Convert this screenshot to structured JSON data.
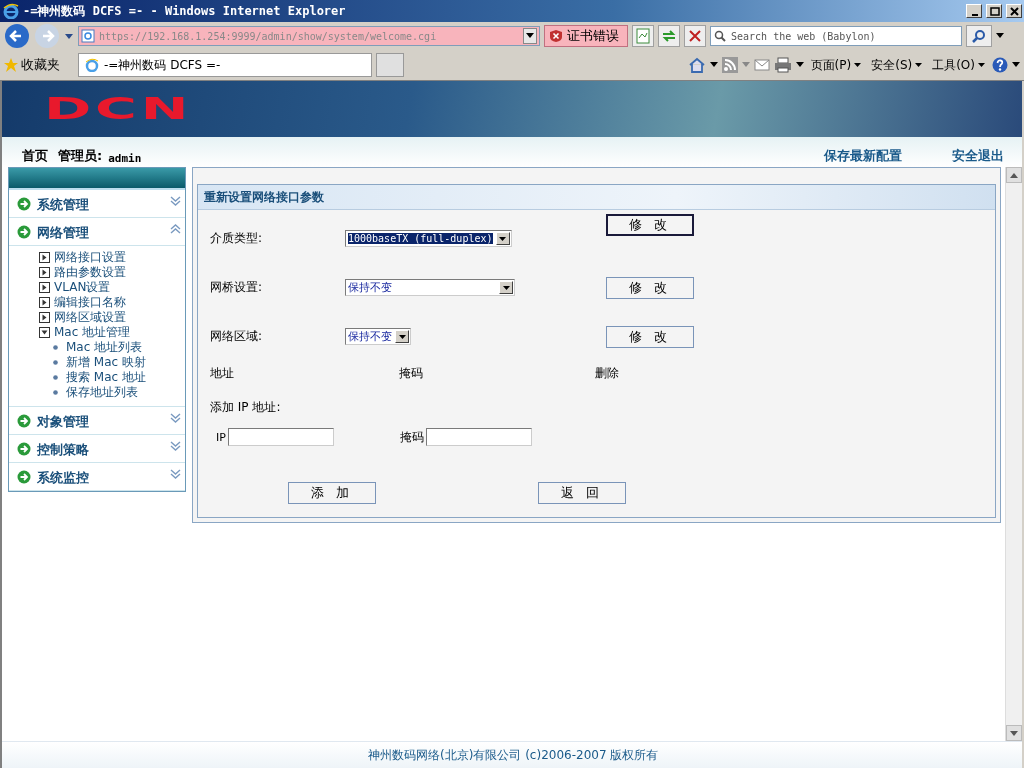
{
  "window": {
    "title": "-=神州数码 DCFS =- - Windows Internet Explorer"
  },
  "browser": {
    "address": "https://192.168.1.254:9999/admin/show/system/welcome.cgi",
    "cert_error": "证书错误",
    "search": {
      "placeholder": "Search the web (Babylon)"
    },
    "favorites": "收藏夹",
    "tabs": [
      {
        "label": "-=神州数码 DCFS =-",
        "selected": true
      }
    ],
    "commands": [
      "页面(P)",
      "安全(S)",
      "工具(O)"
    ]
  },
  "header": {
    "logo": "DCN",
    "home": "首页",
    "admin_label": "管理员:",
    "admin_name": "admin",
    "links": [
      "保存最新配置",
      "安全退出"
    ]
  },
  "sidebar": {
    "sections": [
      {
        "label": "系统管理",
        "expanded": false
      },
      {
        "label": "网络管理",
        "expanded": true,
        "children": [
          {
            "label": "网络接口设置",
            "expanded": false
          },
          {
            "label": "路由参数设置",
            "expanded": false
          },
          {
            "label": "VLAN设置",
            "expanded": false
          },
          {
            "label": "编辑接口名称",
            "expanded": false
          },
          {
            "label": "网络区域设置",
            "expanded": false
          },
          {
            "label": "Mac 地址管理",
            "expanded": true,
            "children": [
              {
                "label": "Mac 地址列表"
              },
              {
                "label": "新增 Mac 映射"
              },
              {
                "label": "搜索 Mac 地址"
              },
              {
                "label": "保存地址列表"
              }
            ]
          }
        ]
      },
      {
        "label": "对象管理",
        "expanded": false
      },
      {
        "label": "控制策略",
        "expanded": false
      },
      {
        "label": "系统监控",
        "expanded": false
      }
    ]
  },
  "form": {
    "title": "重新设置网络接口参数",
    "settings": [
      {
        "label": "介质类型:",
        "value": "1000baseTX (full-duplex)",
        "focused": true,
        "button": "修 改"
      },
      {
        "label": "网桥设置:",
        "value": "保持不变",
        "focused": false,
        "button": "修 改"
      },
      {
        "label": "网络区域:",
        "value": "保持不变",
        "focused": false,
        "button": "修 改"
      }
    ],
    "columns": [
      "地址",
      "掩码",
      "删除"
    ],
    "add_title": "添加 IP 地址:",
    "fields": [
      {
        "label": "IP"
      },
      {
        "label": "掩码"
      }
    ],
    "buttons": [
      "添 加",
      "返 回"
    ]
  },
  "footer": "神州数码网络(北京)有限公司 (c)2006-2007 版权所有"
}
